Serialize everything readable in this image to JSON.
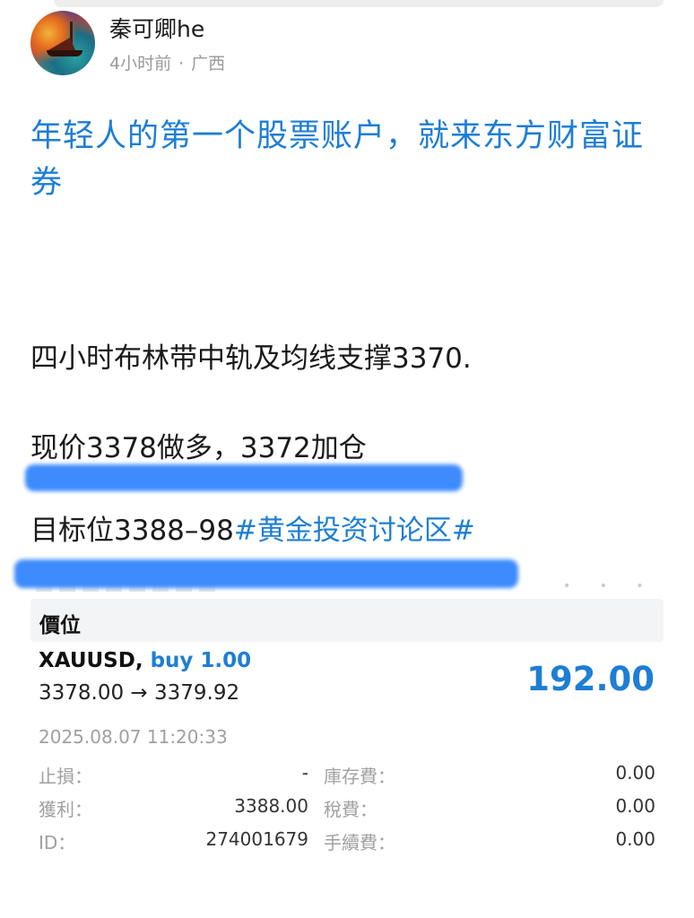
{
  "post": {
    "author": "秦可卿he",
    "time": "4小时前",
    "separator": "·",
    "location": "广西",
    "headline": "年轻人的第一个股票账户，就来东方财富证券",
    "body_line1": "四小时布林带中轨及均线支撑3370.",
    "body_line2": "现价3378做多，3372加仓",
    "body_line3_text": "目标位3388–98",
    "body_line3_tag": "#黄金投资讨论区#"
  },
  "trade": {
    "section_title": "價位",
    "symbol": "XAUUSD,",
    "side": "buy 1.00",
    "price_change": "3378.00 → 3379.92",
    "profit": "192.00",
    "timestamp": "2025.08.07 11:20:33",
    "details": {
      "stop_loss_label": "止損：",
      "stop_loss_value": "-",
      "take_profit_label": "獲利：",
      "take_profit_value": "3388.00",
      "id_label": "ID：",
      "id_value": "274001679",
      "swap_label": "庫存費：",
      "swap_value": "0.00",
      "tax_label": "稅費：",
      "tax_value": "0.00",
      "commission_label": "手續費：",
      "commission_value": "0.00"
    }
  },
  "colors": {
    "link_blue": "#1e7ed4",
    "redaction_blue": "#3d8bfd",
    "muted_gray": "#a0a0a0"
  }
}
